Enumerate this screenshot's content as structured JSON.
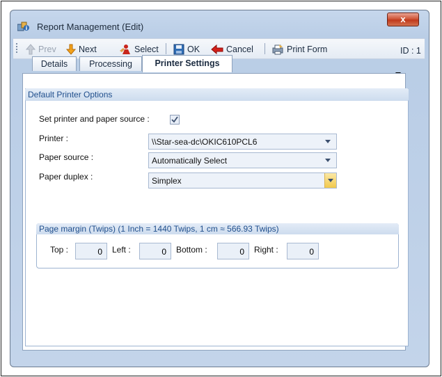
{
  "window": {
    "title": "Report Management (Edit)",
    "close_glyph": "x"
  },
  "toolbar": {
    "prev_label": "Prev",
    "next_label": "Next",
    "select_label": "Select",
    "ok_label": "OK",
    "cancel_label": "Cancel",
    "print_form_label": "Print Form",
    "id_text": "ID : 1"
  },
  "tabs": [
    {
      "label": "Details"
    },
    {
      "label": "Processing"
    },
    {
      "label": "Printer Settings",
      "active": true
    }
  ],
  "printer_options": {
    "group_title": "Default Printer Options",
    "set_printer_label": "Set printer and paper source :",
    "set_printer_checked": true,
    "printer_label": "Printer :",
    "printer_value": "\\\\Star-sea-dc\\OKIC610PCL6",
    "paper_source_label": "Paper source :",
    "paper_source_value": "Automatically Select",
    "paper_duplex_label": "Paper duplex :",
    "paper_duplex_value": "Simplex"
  },
  "page_margin": {
    "group_title": "Page margin (Twips) (1 Inch = 1440 Twips, 1 cm ≈ 566.93 Twips)",
    "top_label": "Top :",
    "top_value": "0",
    "left_label": "Left :",
    "left_value": "0",
    "bottom_label": "Bottom :",
    "bottom_value": "0",
    "right_label": "Right :",
    "right_value": "0"
  },
  "icons": {
    "prev": "arrow-up-icon",
    "next": "arrow-down-icon",
    "select": "select-person-icon",
    "ok": "save-disk-icon",
    "cancel": "red-back-arrow-icon",
    "print_form": "print-form-icon",
    "tab_menu": "chevron-down-icon"
  },
  "colors": {
    "accent": "#1f4e8c",
    "title_bg": "#c6d7ec",
    "close_red": "#c0391c"
  }
}
